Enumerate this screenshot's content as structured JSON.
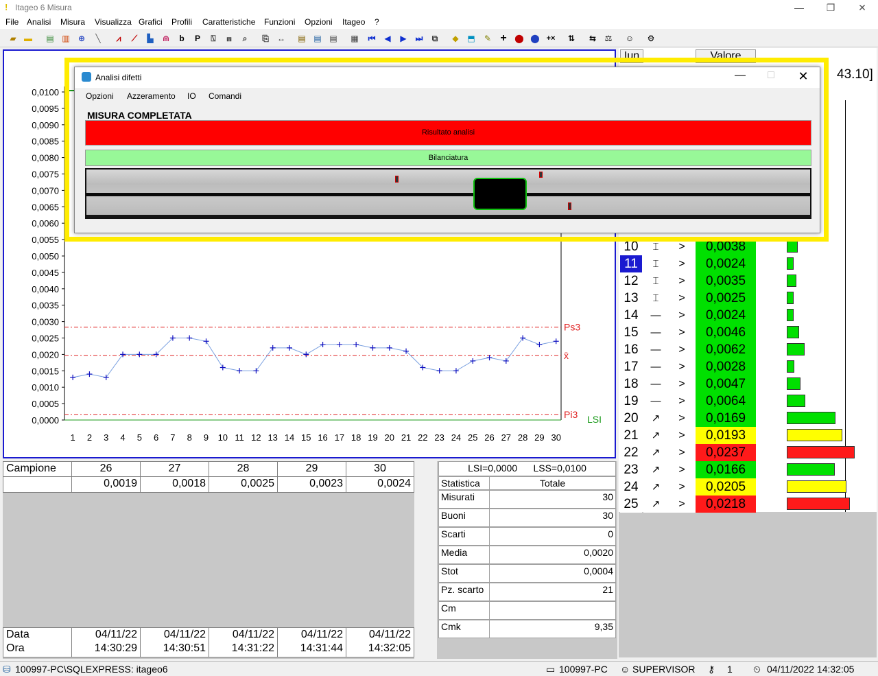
{
  "app": {
    "title": "Itageo 6 Misura"
  },
  "menu": [
    "File",
    "Analisi",
    "Misura",
    "Visualizza",
    "Grafici",
    "Profili",
    "Caratteristiche",
    "Funzioni",
    "Opzioni",
    "Itageo",
    "?"
  ],
  "toolbar_icons": [
    "open-icon",
    "folder-icon",
    "chart-icon",
    "bars-icon",
    "crosshair-icon",
    "line-icon",
    "trend-icon",
    "trend2-icon",
    "histogram-icon",
    "distribution-icon",
    "b-icon",
    "p-icon",
    "chart3-icon",
    "chart4-icon",
    "chart5-icon",
    "copy-icon",
    "resize-icon",
    "note-icon",
    "note2-icon",
    "note3-icon",
    "calendar-icon",
    "first-icon",
    "prev-icon",
    "next-icon",
    "last-icon",
    "window-icon",
    "warning-icon",
    "export-icon",
    "edit-icon",
    "plus-icon",
    "record-icon",
    "record2-icon",
    "multiply-icon",
    "sort-icon",
    "scale-icon",
    "user-icon",
    "settings-icon"
  ],
  "chart_data": {
    "type": "line",
    "x": [
      1,
      2,
      3,
      4,
      5,
      6,
      7,
      8,
      9,
      10,
      11,
      12,
      13,
      14,
      15,
      16,
      17,
      18,
      19,
      20,
      21,
      22,
      23,
      24,
      25,
      26,
      27,
      28,
      29,
      30
    ],
    "series": [
      {
        "values": [
          0.0013,
          0.0014,
          0.0013,
          0.002,
          0.002,
          0.002,
          0.0025,
          0.0025,
          0.0024,
          0.0016,
          0.0015,
          0.0015,
          0.0022,
          0.0022,
          0.002,
          0.0023,
          0.0023,
          0.0023,
          0.0022,
          0.0022,
          0.0021,
          0.0016,
          0.0015,
          0.0015,
          0.0018,
          0.0019,
          0.0018,
          0.0025,
          0.0023,
          0.0024
        ]
      }
    ],
    "ylim": [
      0,
      0.01
    ],
    "yticks": [
      "0,0000",
      "0,0005",
      "0,0010",
      "0,0015",
      "0,0020",
      "0,0025",
      "0,0030",
      "0,0035",
      "0,0040",
      "0,0045",
      "0,0050",
      "0,0055",
      "0,0060",
      "0,0065",
      "0,0070",
      "0,0075",
      "0,0080",
      "0,0085",
      "0,0090",
      "0,0095",
      "0,0100"
    ],
    "reference_lines": [
      {
        "label": "Ps3",
        "value": 0.00283,
        "color": "#e02020"
      },
      {
        "label": "x̄",
        "value": 0.00197,
        "color": "#e02020"
      },
      {
        "label": "Pi3",
        "value": 0.00017,
        "color": "#e02020"
      },
      {
        "label": "LSI",
        "value": 0.0,
        "color": "#1a9a1a"
      }
    ],
    "line_color": "#7aa0e0",
    "marker_color": "#1010c0"
  },
  "samples": {
    "header_label": "Campione",
    "columns": [
      "26",
      "27",
      "28",
      "29",
      "30"
    ],
    "values": [
      "0,0019",
      "0,0018",
      "0,0025",
      "0,0023",
      "0,0024"
    ],
    "date_label": "Data",
    "time_label": "Ora",
    "dates": [
      "04/11/22",
      "04/11/22",
      "04/11/22",
      "04/11/22",
      "04/11/22"
    ],
    "times": [
      "14:30:29",
      "14:30:51",
      "14:31:22",
      "14:31:44",
      "14:32:05"
    ]
  },
  "stats": {
    "limits": "LSI=0,0000      LSS=0,0100",
    "col1": "Statistica",
    "col2": "Totale",
    "rows": [
      {
        "label": "Misurati",
        "value": "30"
      },
      {
        "label": "Buoni",
        "value": "30"
      },
      {
        "label": "Scarti",
        "value": "0"
      },
      {
        "label": "Media",
        "value": "0,0020"
      },
      {
        "label": "Stot",
        "value": "0,0004"
      },
      {
        "label": "Pz. scarto",
        "value": "21"
      },
      {
        "label": "Cm",
        "value": ""
      },
      {
        "label": "Cmk",
        "value": "9,35"
      }
    ]
  },
  "measure_table": {
    "header_col1": "Iun",
    "header_value": "Valore",
    "range_text": "43.10]",
    "rows": [
      {
        "n": "10",
        "symbol": "⌶",
        "cmp": ">",
        "value": "0,0038",
        "status": "green",
        "bar": 0.11
      },
      {
        "n": "11",
        "symbol": "⌶",
        "cmp": ">",
        "value": "0,0024",
        "status": "green",
        "bar": 0.07,
        "selected": true
      },
      {
        "n": "12",
        "symbol": "⌶",
        "cmp": ">",
        "value": "0,0035",
        "status": "green",
        "bar": 0.1
      },
      {
        "n": "13",
        "symbol": "⌶",
        "cmp": ">",
        "value": "0,0025",
        "status": "green",
        "bar": 0.07
      },
      {
        "n": "14",
        "symbol": "—",
        "cmp": ">",
        "value": "0,0024",
        "status": "green",
        "bar": 0.07
      },
      {
        "n": "15",
        "symbol": "—",
        "cmp": ">",
        "value": "0,0046",
        "status": "green",
        "bar": 0.13
      },
      {
        "n": "16",
        "symbol": "—",
        "cmp": ">",
        "value": "0,0062",
        "status": "green",
        "bar": 0.18
      },
      {
        "n": "17",
        "symbol": "—",
        "cmp": ">",
        "value": "0,0028",
        "status": "green",
        "bar": 0.08
      },
      {
        "n": "18",
        "symbol": "—",
        "cmp": ">",
        "value": "0,0047",
        "status": "green",
        "bar": 0.14
      },
      {
        "n": "19",
        "symbol": "—",
        "cmp": ">",
        "value": "0,0064",
        "status": "green",
        "bar": 0.19
      },
      {
        "n": "20",
        "symbol": "↗",
        "cmp": ">",
        "value": "0,0169",
        "status": "green",
        "bar": 0.5
      },
      {
        "n": "21",
        "symbol": "↗",
        "cmp": ">",
        "value": "0,0193",
        "status": "yellow",
        "bar": 0.57
      },
      {
        "n": "22",
        "symbol": "↗",
        "cmp": ">",
        "value": "0,0237",
        "status": "red",
        "bar": 0.7
      },
      {
        "n": "23",
        "symbol": "↗",
        "cmp": ">",
        "value": "0,0166",
        "status": "green",
        "bar": 0.49
      },
      {
        "n": "24",
        "symbol": "↗",
        "cmp": ">",
        "value": "0,0205",
        "status": "yellow",
        "bar": 0.61
      },
      {
        "n": "25",
        "symbol": "↗",
        "cmp": ">",
        "value": "0,0218",
        "status": "red",
        "bar": 0.65
      }
    ]
  },
  "status_bar": {
    "db": "100997-PC\\SQLEXPRESS: itageo6",
    "pc": "100997-PC",
    "user": "SUPERVISOR",
    "count": "1",
    "datetime": "04/11/2022 14:32:05"
  },
  "dialog": {
    "title": "Analisi difetti",
    "menu": [
      "Opzioni",
      "Azzeramento",
      "IO",
      "Comandi"
    ],
    "heading": "MISURA COMPLETATA",
    "result_label": "Risultato analisi",
    "result_color": "#ff0000",
    "balance_label": "Bilanciatura",
    "balance_color": "#98f898"
  },
  "colors": {
    "green": "#00e000",
    "yellow": "#ffff00",
    "red": "#ff1a1a",
    "highlight": "#ffec00"
  }
}
